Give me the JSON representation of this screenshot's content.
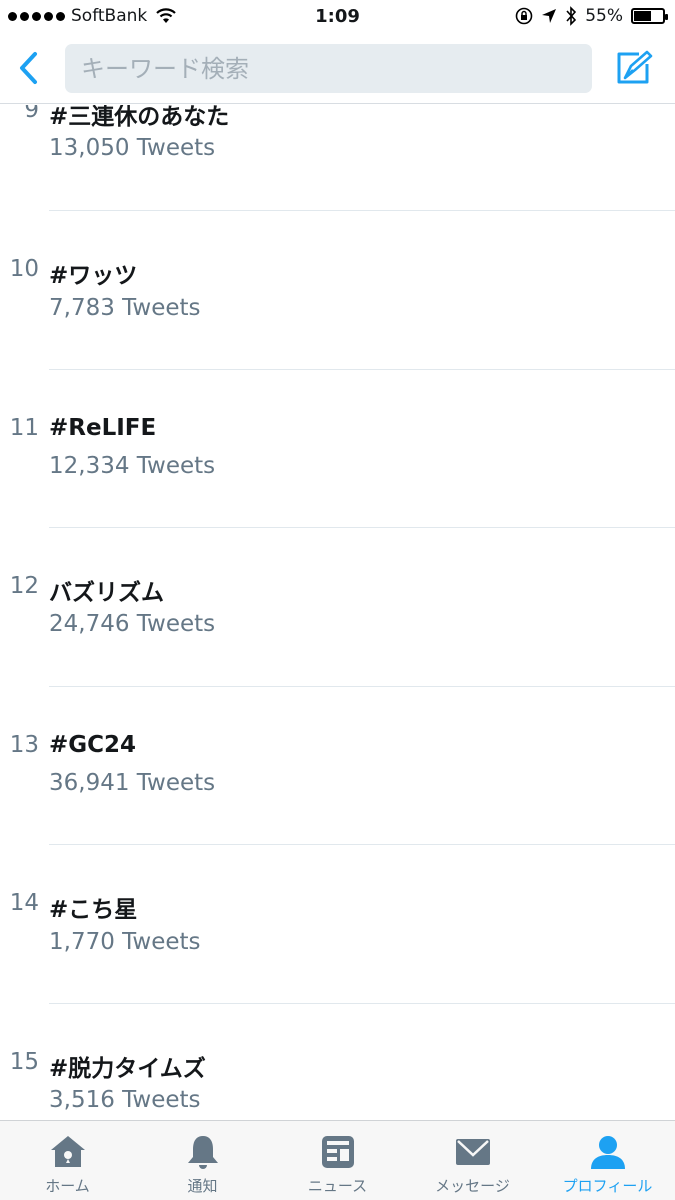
{
  "status_bar": {
    "carrier": "SoftBank",
    "time": "1:09",
    "battery": "55%",
    "battery_level": 0.55
  },
  "nav": {
    "search_placeholder": "キーワード検索",
    "back_icon": "chevron-left-icon",
    "compose_icon": "compose-tweet-icon"
  },
  "trends": [
    {
      "rank": "9",
      "name": "#三連休のあなた",
      "count": "13,050 Tweets"
    },
    {
      "rank": "10",
      "name": "#ワッツ",
      "count": "7,783 Tweets"
    },
    {
      "rank": "11",
      "name": "#ReLIFE",
      "count": "12,334 Tweets"
    },
    {
      "rank": "12",
      "name": "バズリズム",
      "count": "24,746 Tweets"
    },
    {
      "rank": "13",
      "name": "#GC24",
      "count": "36,941 Tweets"
    },
    {
      "rank": "14",
      "name": "#こち星",
      "count": "1,770 Tweets"
    },
    {
      "rank": "15",
      "name": "#脱力タイムズ",
      "count": "3,516 Tweets"
    }
  ],
  "tabs": [
    {
      "label": "ホーム",
      "icon": "home-icon",
      "active": false
    },
    {
      "label": "通知",
      "icon": "bell-icon",
      "active": false
    },
    {
      "label": "ニュース",
      "icon": "news-icon",
      "active": false
    },
    {
      "label": "メッセージ",
      "icon": "envelope-icon",
      "active": false
    },
    {
      "label": "プロフィール",
      "icon": "profile-icon",
      "active": true
    }
  ],
  "colors": {
    "accent": "#1da1f2",
    "text": "#14171a",
    "secondary": "#657786",
    "search_bg": "#e6ecf0"
  }
}
